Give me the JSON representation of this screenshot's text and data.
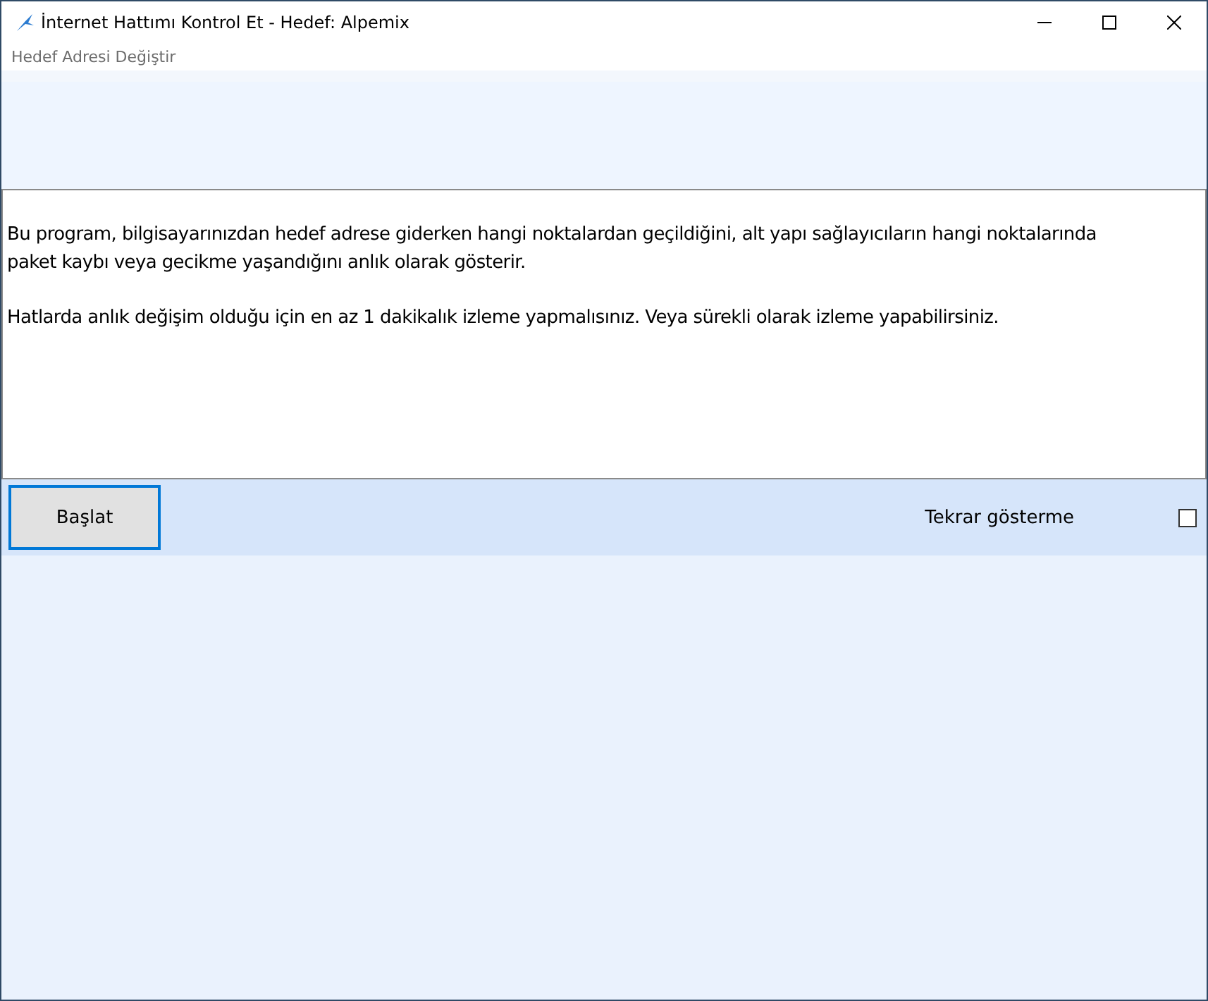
{
  "window": {
    "title": "İnternet Hattımı Kontrol Et - Hedef: Alpemix"
  },
  "menu": [
    "Hedef Adresi Değiştir"
  ],
  "description": [
    "Bu program, bilgisayarınızdan hedef adrese giderken hangi noktalardan geçildiğini, alt yapı sağlayıcıların hangi noktalarında paket kaybı veya gecikme yaşandığını anlık olarak gösterir.",
    "Hatlarda anlık değişim olduğu için en az 1 dakikalık izleme yapmalısınız. Veya sürekli olarak izleme yapabilirsiniz."
  ],
  "start_button": "Başlat",
  "dont_show_again": {
    "label": "Tekrar gösterme",
    "checked": false
  }
}
